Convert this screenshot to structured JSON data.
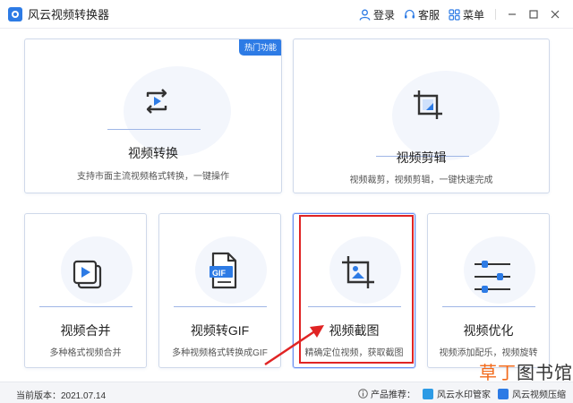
{
  "app": {
    "title": "风云视频转换器"
  },
  "titlebar": {
    "login": "登录",
    "service": "客服",
    "menu": "菜单"
  },
  "cards": {
    "convert": {
      "title": "视频转换",
      "desc": "支持市面主流视频格式转换，一键操作",
      "badge": "热门功能"
    },
    "edit": {
      "title": "视频剪辑",
      "desc": "视频裁剪，视频剪辑，一键快速完成"
    },
    "merge": {
      "title": "视频合并",
      "desc": "多种格式视频合并"
    },
    "gif": {
      "title": "视频转GIF",
      "desc": "多种视频格式转换成GIF",
      "icon_text": "GIF"
    },
    "crop": {
      "title": "视频截图",
      "desc": "精确定位视频，获取截图"
    },
    "optimize": {
      "title": "视频优化",
      "desc": "视频添加配乐，视频旋转"
    }
  },
  "status": {
    "version": "当前版本：2021.07.14",
    "recommend_label": "产品推荐：",
    "rec1": "风云水印管家",
    "rec2": "风云视频压缩"
  },
  "watermark": {
    "part1": "草丁",
    "part2": "图书馆"
  },
  "colors": {
    "accent": "#2d7be5",
    "highlight": "#e02424",
    "watermark": "#f26b1d"
  }
}
